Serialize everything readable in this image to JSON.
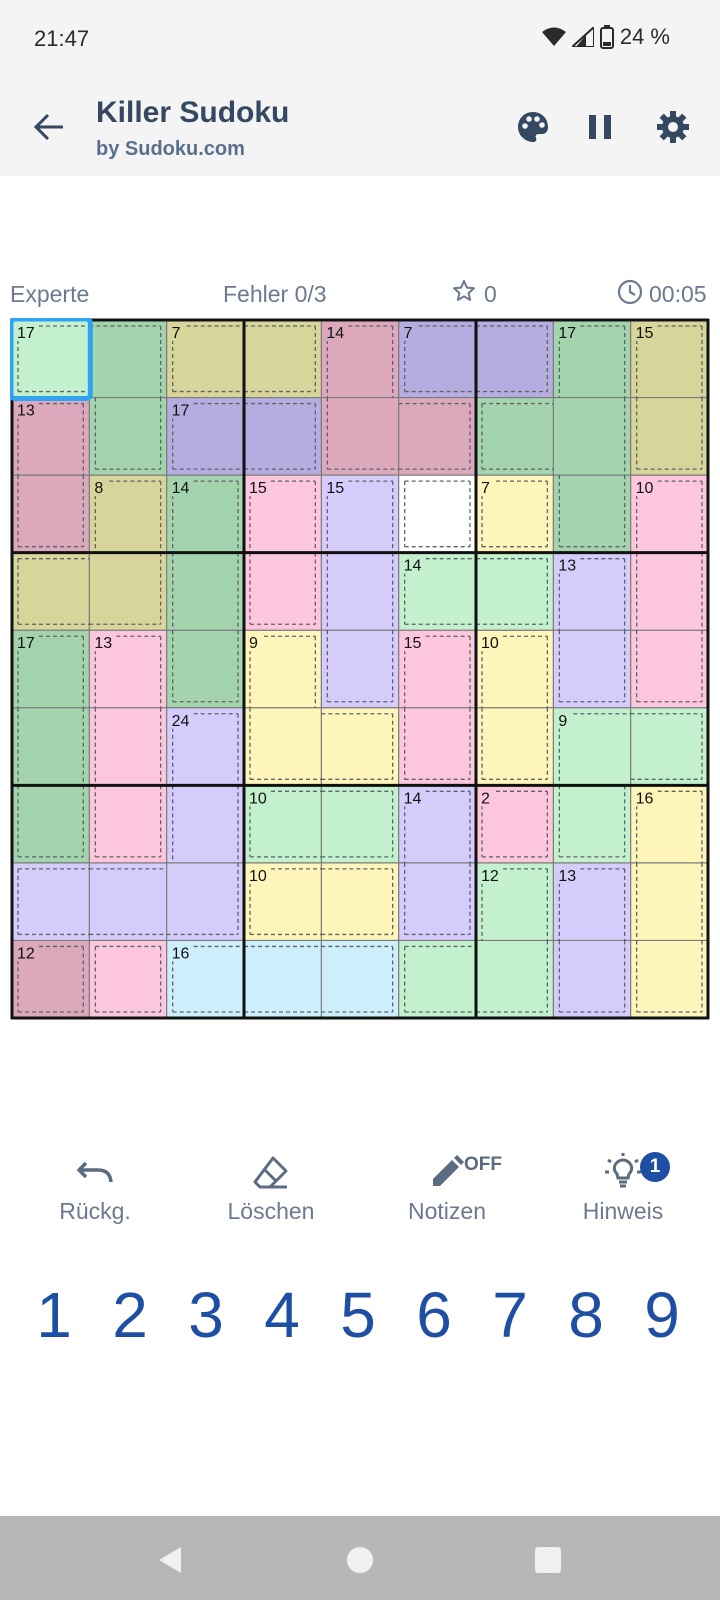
{
  "status": {
    "time": "21:47",
    "battery": "24 %"
  },
  "header": {
    "title": "Killer Sudoku",
    "subtitle": "by Sudoku.com"
  },
  "info": {
    "difficulty": "Experte",
    "mistakes": "Fehler 0/3",
    "score": "0",
    "timer": "00:05"
  },
  "board": {
    "selected_cell": {
      "row": 0,
      "col": 0
    },
    "cages": [
      {
        "sum": "17",
        "color": "#a4d4ae",
        "cells": [
          [
            0,
            0
          ],
          [
            0,
            1
          ],
          [
            1,
            1
          ],
          [
            2,
            1
          ]
        ]
      },
      {
        "sum": "7",
        "color": "#d8d59a",
        "cells": [
          [
            0,
            2
          ],
          [
            0,
            3
          ]
        ]
      },
      {
        "sum": "14",
        "color": "#dba9bb",
        "cells": [
          [
            0,
            4
          ],
          [
            1,
            4
          ],
          [
            1,
            5
          ]
        ]
      },
      {
        "sum": "7",
        "color": "#b5ace0",
        "cells": [
          [
            0,
            5
          ],
          [
            0,
            6
          ]
        ]
      },
      {
        "sum": "17",
        "color": "#a4d4ae",
        "cells": [
          [
            0,
            7
          ],
          [
            1,
            6
          ],
          [
            1,
            7
          ],
          [
            2,
            7
          ]
        ]
      },
      {
        "sum": "15",
        "color": "#d8d59a",
        "cells": [
          [
            0,
            8
          ],
          [
            1,
            8
          ]
        ]
      },
      {
        "sum": "13",
        "color": "#dba9bb",
        "cells": [
          [
            1,
            0
          ],
          [
            2,
            0
          ]
        ]
      },
      {
        "sum": "17",
        "color": "#b5ace0",
        "cells": [
          [
            1,
            2
          ],
          [
            1,
            3
          ]
        ]
      },
      {
        "sum": "8",
        "color": "#d8d59a",
        "cells": [
          [
            2,
            1
          ],
          [
            3,
            0
          ],
          [
            3,
            1
          ]
        ]
      },
      {
        "sum": "14",
        "color": "#a4d4ae",
        "cells": [
          [
            2,
            2
          ],
          [
            3,
            2
          ],
          [
            4,
            2
          ]
        ]
      },
      {
        "sum": "15",
        "color": "#fcc6dd",
        "cells": [
          [
            2,
            3
          ],
          [
            3,
            3
          ]
        ]
      },
      {
        "sum": "15",
        "color": "#d6ccfc",
        "cells": [
          [
            2,
            4
          ],
          [
            3,
            4
          ],
          [
            4,
            4
          ]
        ]
      },
      {
        "sum": "7",
        "color": "#fdf5b9",
        "cells": [
          [
            2,
            6
          ]
        ]
      },
      {
        "sum": "10",
        "color": "#fcc6dd",
        "cells": [
          [
            2,
            8
          ],
          [
            3,
            8
          ],
          [
            4,
            8
          ]
        ]
      },
      {
        "sum": "14",
        "color": "#c3f0cd",
        "cells": [
          [
            3,
            5
          ],
          [
            3,
            6
          ]
        ]
      },
      {
        "sum": "13",
        "color": "#d6ccfc",
        "cells": [
          [
            3,
            7
          ],
          [
            4,
            7
          ]
        ]
      },
      {
        "sum": "17",
        "color": "#a4d4ae",
        "cells": [
          [
            4,
            0
          ],
          [
            5,
            0
          ],
          [
            6,
            0
          ]
        ]
      },
      {
        "sum": "13",
        "color": "#fcc6dd",
        "cells": [
          [
            4,
            1
          ],
          [
            5,
            1
          ],
          [
            6,
            1
          ]
        ]
      },
      {
        "sum": "9",
        "color": "#fdf5b9",
        "cells": [
          [
            4,
            3
          ],
          [
            5,
            3
          ],
          [
            5,
            4
          ]
        ]
      },
      {
        "sum": "15",
        "color": "#fcc6dd",
        "cells": [
          [
            4,
            5
          ],
          [
            5,
            5
          ]
        ]
      },
      {
        "sum": "10",
        "color": "#fdf5b9",
        "cells": [
          [
            4,
            6
          ],
          [
            5,
            6
          ]
        ]
      },
      {
        "sum": "24",
        "color": "#d6ccfc",
        "cells": [
          [
            5,
            2
          ],
          [
            6,
            2
          ],
          [
            7,
            0
          ],
          [
            7,
            1
          ],
          [
            7,
            2
          ]
        ]
      },
      {
        "sum": "9",
        "color": "#c3f0cd",
        "cells": [
          [
            5,
            7
          ],
          [
            5,
            8
          ],
          [
            6,
            7
          ]
        ]
      },
      {
        "sum": "10",
        "color": "#c3f0cd",
        "cells": [
          [
            6,
            3
          ],
          [
            6,
            4
          ]
        ]
      },
      {
        "sum": "14",
        "color": "#d6ccfc",
        "cells": [
          [
            6,
            5
          ],
          [
            7,
            5
          ]
        ]
      },
      {
        "sum": "2",
        "color": "#fcc6dd",
        "cells": [
          [
            6,
            6
          ]
        ]
      },
      {
        "sum": "16",
        "color": "#fdf5b9",
        "cells": [
          [
            6,
            8
          ],
          [
            7,
            8
          ],
          [
            8,
            8
          ]
        ]
      },
      {
        "sum": "10",
        "color": "#fdf5b9",
        "cells": [
          [
            7,
            3
          ],
          [
            7,
            4
          ]
        ]
      },
      {
        "sum": "12",
        "color": "#c3f0cd",
        "cells": [
          [
            7,
            6
          ],
          [
            8,
            5
          ],
          [
            8,
            6
          ]
        ]
      },
      {
        "sum": "13",
        "color": "#d6ccfc",
        "cells": [
          [
            7,
            7
          ],
          [
            8,
            7
          ]
        ]
      },
      {
        "sum": "12",
        "color": "#dba9bb",
        "cells": [
          [
            8,
            0
          ]
        ]
      },
      {
        "sum": "",
        "color": "#fcc6dd",
        "cells": [
          [
            8,
            1
          ]
        ]
      },
      {
        "sum": "16",
        "color": "#cdeffb",
        "cells": [
          [
            8,
            2
          ],
          [
            8,
            3
          ],
          [
            8,
            4
          ]
        ]
      }
    ],
    "colors": {
      "selected": "#c3f0cd",
      "select_border": "#2ea3f2",
      "grid": "#7a7a7a",
      "box_border": "#111111"
    }
  },
  "toolbar": {
    "undo": "Rückg.",
    "erase": "Löschen",
    "notes": "Notizen",
    "notes_state": "OFF",
    "hint": "Hinweis",
    "hint_count": "1"
  },
  "numpad": [
    "1",
    "2",
    "3",
    "4",
    "5",
    "6",
    "7",
    "8",
    "9"
  ],
  "icons": {
    "back": "arrow-left-icon",
    "palette": "palette-icon",
    "pause": "pause-icon",
    "settings": "gear-icon",
    "undo": "undo-icon",
    "erase": "eraser-icon",
    "notes": "pencil-icon",
    "hint": "lightbulb-icon"
  }
}
